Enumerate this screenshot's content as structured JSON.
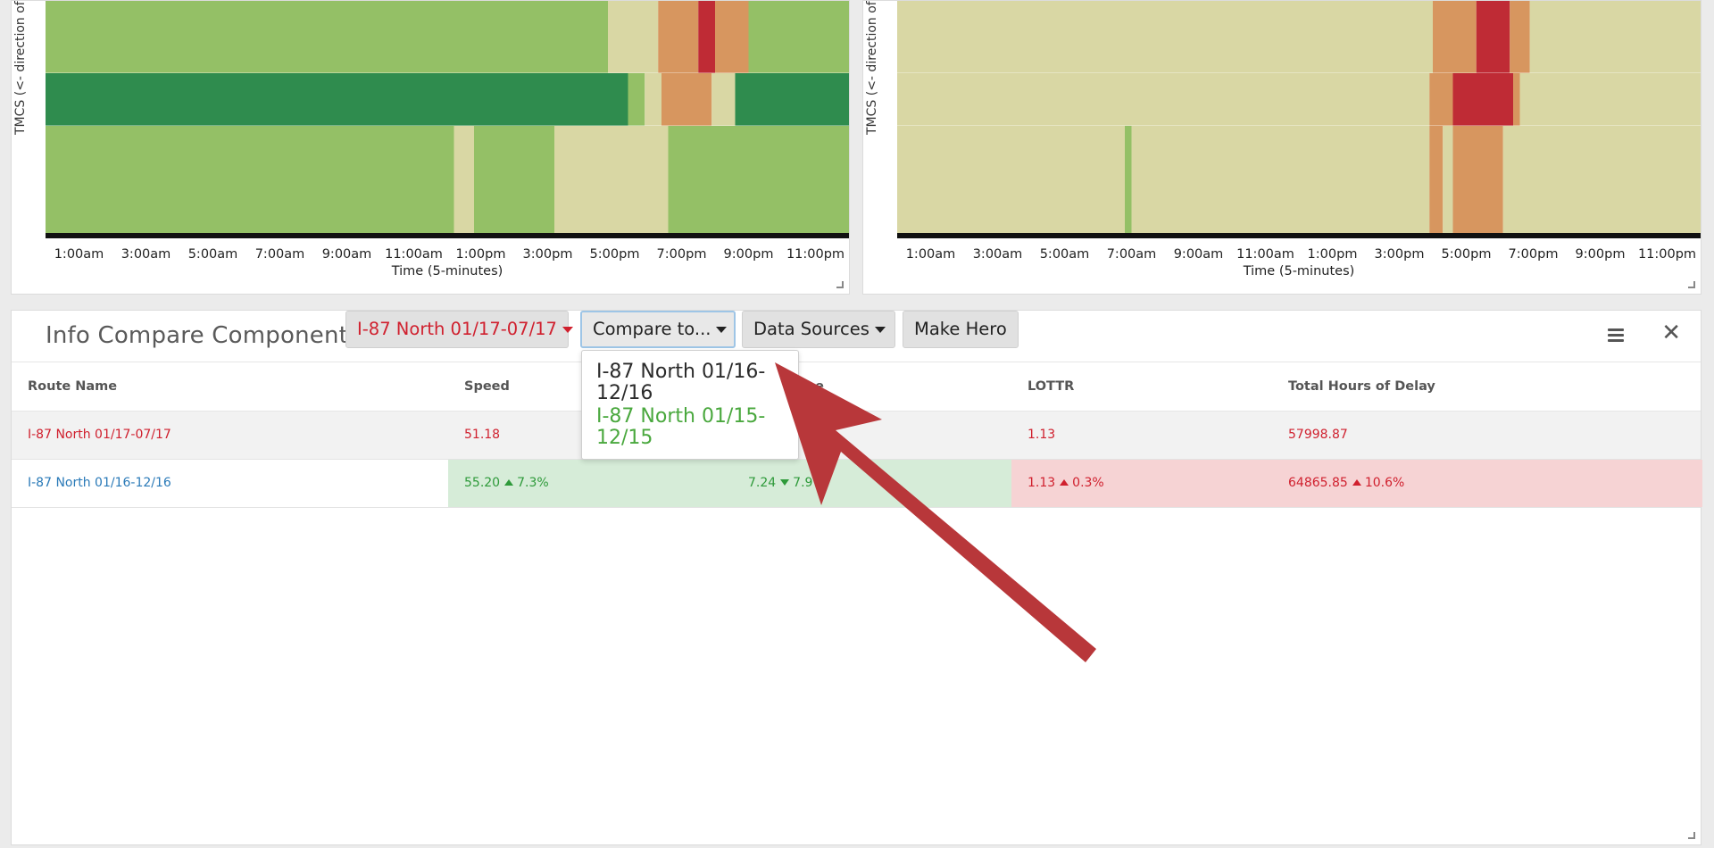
{
  "charts": {
    "left": {
      "y_axis_label": "TMCS (<- direction of",
      "x_axis_title": "Time (5-minutes)",
      "x_ticks": [
        "1:00am",
        "3:00am",
        "5:00am",
        "7:00am",
        "9:00am",
        "11:00am",
        "1:00pm",
        "3:00pm",
        "5:00pm",
        "7:00pm",
        "9:00pm",
        "11:00pm"
      ]
    },
    "right": {
      "y_axis_label": "TMCS (<- direction of",
      "x_axis_title": "Time (5-minutes)",
      "x_ticks": [
        "1:00am",
        "3:00am",
        "5:00am",
        "7:00am",
        "9:00am",
        "11:00am",
        "1:00pm",
        "3:00pm",
        "5:00pm",
        "7:00pm",
        "9:00pm",
        "11:00pm"
      ]
    }
  },
  "chart_data": [
    {
      "type": "heatmap",
      "xlabel": "Time (5-minutes)",
      "ylabel": "TMCS (<- direction of",
      "rows": [
        {
          "segments": [
            [
              "light-green",
              0,
              16.8
            ],
            [
              "tan",
              16.8,
              18.3
            ],
            [
              "orange",
              18.3,
              19.5
            ],
            [
              "red",
              19.5,
              20.0
            ],
            [
              "orange",
              20.0,
              21.0
            ],
            [
              "light-green",
              21.0,
              24
            ]
          ]
        },
        {
          "segments": [
            [
              "dark-green",
              0,
              17.4
            ],
            [
              "light-green",
              17.4,
              17.9
            ],
            [
              "tan",
              17.9,
              18.4
            ],
            [
              "orange",
              18.4,
              19.9
            ],
            [
              "tan",
              19.9,
              20.6
            ],
            [
              "dark-green",
              20.6,
              24
            ]
          ]
        },
        {
          "segments": [
            [
              "light-green",
              0,
              12.2
            ],
            [
              "tan",
              12.2,
              12.8
            ],
            [
              "light-green",
              12.8,
              15.2
            ],
            [
              "tan",
              15.2,
              18.6
            ],
            [
              "light-green",
              18.6,
              24
            ]
          ]
        }
      ]
    },
    {
      "type": "heatmap",
      "xlabel": "Time (5-minutes)",
      "ylabel": "TMCS (<- direction of",
      "rows": [
        {
          "segments": [
            [
              "tan",
              0,
              16.0
            ],
            [
              "orange",
              16.0,
              17.3
            ],
            [
              "red",
              17.3,
              18.3
            ],
            [
              "orange",
              18.3,
              18.9
            ],
            [
              "tan",
              18.9,
              24
            ]
          ]
        },
        {
          "segments": [
            [
              "tan",
              0,
              15.9
            ],
            [
              "orange",
              15.9,
              16.6
            ],
            [
              "red",
              16.6,
              18.4
            ],
            [
              "orange",
              18.4,
              18.6
            ],
            [
              "tan",
              18.6,
              24
            ]
          ]
        },
        {
          "segments": [
            [
              "tan",
              0,
              6.8
            ],
            [
              "light-green",
              6.8,
              7.0
            ],
            [
              "tan",
              7.0,
              15.9
            ],
            [
              "orange",
              15.9,
              16.3
            ],
            [
              "tan",
              16.3,
              16.6
            ],
            [
              "orange",
              16.6,
              18.1
            ],
            [
              "tan",
              18.1,
              24
            ]
          ]
        }
      ]
    }
  ],
  "info_compare": {
    "title": "Info Compare Component",
    "route_button": "I-87 North 01/17-07/17",
    "compare_button": "Compare to...",
    "data_sources_button": "Data Sources",
    "make_hero_button": "Make Hero",
    "headers": [
      "Route Name",
      "Speed",
      "ime",
      "LOTTR",
      "Total Hours of Delay"
    ],
    "rows": [
      {
        "route": "I-87 North 01/17-07/17",
        "speed": "51.18",
        "time": "",
        "lottr": "1.13",
        "delay": "57998.87"
      },
      {
        "route": "I-87 North 01/16-12/16",
        "speed": "55.20",
        "speed_change": "7.3%",
        "time": "7.24",
        "time_change": "7.9%",
        "lottr": "1.13",
        "lottr_change": "0.3%",
        "delay": "64865.85",
        "delay_change": "10.6%"
      }
    ],
    "dropdown_items": [
      "I-87 North 01/16-12/16",
      "I-87 North 01/15-12/15"
    ]
  },
  "colors": {
    "accent_red": "#d0202e",
    "link_blue": "#2a7ab8",
    "positive_green": "#2e9a3a",
    "annotation_arrow": "#b8373a"
  }
}
